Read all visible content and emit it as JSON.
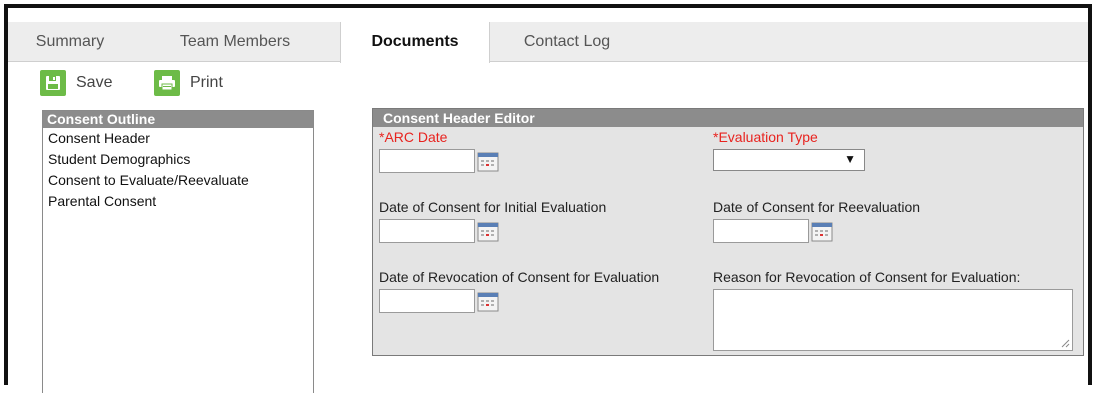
{
  "tabs": [
    {
      "label": "Summary"
    },
    {
      "label": "Team Members"
    },
    {
      "label": "Documents"
    },
    {
      "label": "Contact Log"
    }
  ],
  "active_tab": "Documents",
  "toolbar": {
    "save_label": "Save",
    "print_label": "Print"
  },
  "outline": {
    "title": "Consent Outline",
    "items": [
      {
        "label": "Consent Header"
      },
      {
        "label": "Student Demographics"
      },
      {
        "label": "Consent to Evaluate/Reevaluate"
      },
      {
        "label": "Parental Consent"
      }
    ]
  },
  "editor": {
    "title": "Consent Header Editor",
    "arc_date": {
      "label": "*ARC Date",
      "value": ""
    },
    "evaluation_type": {
      "label": "*Evaluation Type",
      "selected": ""
    },
    "consent_initial": {
      "label": "Date of Consent for Initial Evaluation",
      "value": ""
    },
    "consent_reeval": {
      "label": "Date of Consent for Reevaluation",
      "value": ""
    },
    "revocation_date": {
      "label": "Date of Revocation of Consent for Evaluation",
      "value": ""
    },
    "revocation_reason": {
      "label": "Reason for Revocation of Consent for Evaluation:",
      "value": ""
    }
  },
  "colors": {
    "accent_green": "#6dbb47",
    "required_red": "#e8231f",
    "panel_header": "#8c8c8c"
  }
}
